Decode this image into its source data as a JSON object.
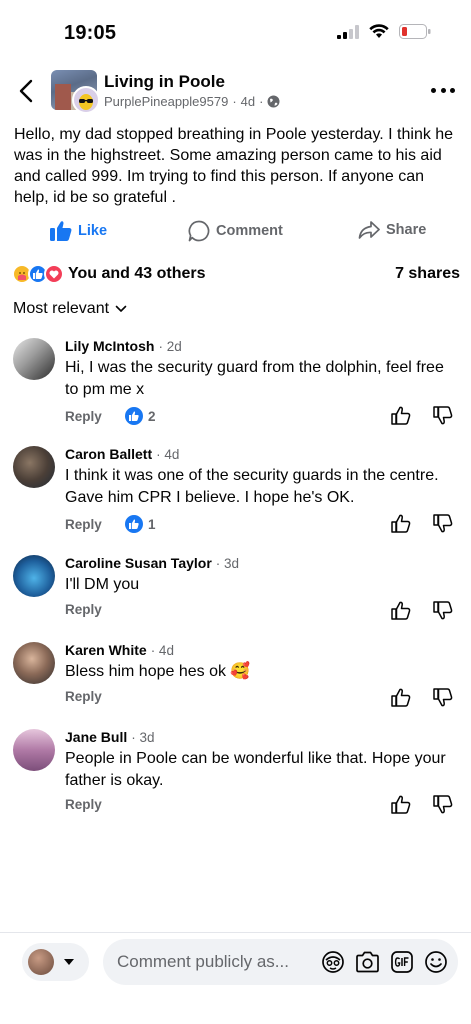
{
  "status_bar": {
    "time": "19:05"
  },
  "header": {
    "group_name": "Living in Poole",
    "author": "PurplePineapple9579",
    "sep1": "·",
    "age": "4d",
    "sep2": "·"
  },
  "post": {
    "text": "Hello, my dad stopped breathing in Poole yesterday. I think he was in the highstreet. Some amazing person came to his aid and called 999. Im trying to find this person. If anyone can help, id be so grateful ."
  },
  "actions": {
    "like": "Like",
    "comment": "Comment",
    "share": "Share"
  },
  "reactions": {
    "summary": "You and 43 others",
    "shares": "7 shares"
  },
  "sort": {
    "label": "Most relevant"
  },
  "comments": [
    {
      "name": "Lily McIntosh",
      "time": "· 2d",
      "text": "Hi, I was the security guard from the dolphin, feel free to pm me x",
      "reply": "Reply",
      "likes": "2"
    },
    {
      "name": "Caron Ballett",
      "time": "· 4d",
      "text": "I think it was one of the security guards in the centre. Gave him CPR I believe. I hope he's OK.",
      "reply": "Reply",
      "likes": "1"
    },
    {
      "name": "Caroline Susan Taylor",
      "time": "· 3d",
      "text": "I'll DM you",
      "reply": "Reply"
    },
    {
      "name": "Karen White",
      "time": "· 4d",
      "text": "Bless him hope hes ok 🥰",
      "reply": "Reply"
    },
    {
      "name": "Jane Bull",
      "time": "· 3d",
      "text": "People in Poole can be wonderful like that. Hope your father is okay.",
      "reply": "Reply"
    }
  ],
  "composer": {
    "placeholder": "Comment publicly as..."
  },
  "colors": {
    "accent": "#1877f2",
    "muted": "#65676b",
    "battery": "#e0312c"
  }
}
